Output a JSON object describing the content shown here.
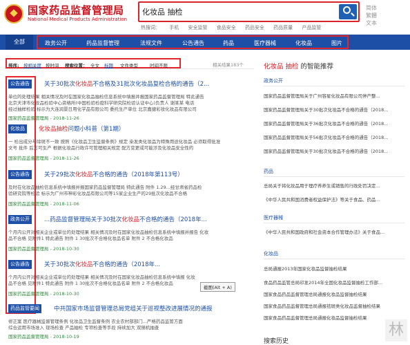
{
  "header": {
    "logo_cn": "国家药品监督管理局",
    "logo_en": "National Medical Products Administration",
    "search_value": "化妆品 抽检",
    "hotwords": [
      "热搜词：",
      "手机",
      "安全监管",
      "食品安全",
      "药品安全",
      "药品质量",
      "产品监管"
    ],
    "lang": [
      "简体",
      "繁體",
      "文本"
    ]
  },
  "nav": {
    "all": "全部",
    "items": [
      "政务公开",
      "药品监督管理",
      "法规文件",
      "公告通告",
      "药品",
      "医疗器械",
      "化妆品",
      "图片"
    ]
  },
  "filter": {
    "sort_label": "排序:",
    "sort_relevance": "按相关度",
    "sort_time": "按时间",
    "pos_label": "搜索位置：",
    "pos_all": "全文",
    "pos_title": "标题",
    "type": "文件类型",
    "time": "时间不限",
    "count": "相关结果183个"
  },
  "results": [
    {
      "tag": "公告通告",
      "title_pre": "关于30批次",
      "title_hl": "化妆品",
      "title_post": "不合格及31批次化妆品复检合格的通告（2...",
      "lines": [
        "单位的处理结果 相关情况及时在国家化妆品抽检信息系统中填报并报国家药品监督管理局 特此通告",
        "北京天津市化妆品检验中心资格所(中国检验检疫科学研究院检验认证中心)负责人 谢某某 电话",
        "经过抽样检验 标示为大连润景日用化学品有限公司 委托生产单位 北京嘉捷彩妆化妆品有限公司"
      ],
      "date": "国家药品监督管理局 - 2018-11-26"
    },
    {
      "tag": "化妆品",
      "title_pre": "",
      "title_hl": "化妆品抽检",
      "title_post": "问题小科普（第1期）",
      "lines": [
        "一 检出成分与除斑不一致 按照《化妆品卫生监督条例》规定 染发类化妆品为特殊用途化妆品 必须取得批准",
        "文号 批件 后方可生产 根据化妆品行政许可管理相关规定 配方变更或可能涉及化妆品安全性的"
      ],
      "date": "国家药品监督管理局 - 2018-11-26"
    },
    {
      "tag": "公告通告",
      "title_pre": "关于29批次",
      "title_hl": "化妆品",
      "title_post": "不合格的通告（2018年第113号）",
      "lines": [
        "及时在化妆品抽检信息系统中填报并报国家药品监督管理局 特此通告 附件 1.29...经甘肃省药品检",
        "验研究院等检验 标示为广州市神彩化妆品有限公司等15家企业生产的29批次化妆品不合格"
      ],
      "date": "国家药品监督管理局 - 2018-11-06"
    },
    {
      "tag": "政务公开",
      "title_pre": "...药品监督管理局关于30批次",
      "title_hl": "化妆品",
      "title_post": "不合格的通告（2018年...",
      "lines": [
        "个月内公开对相关企业或单位的处理结果 相关情况及时在国家化妆品抽检信息系统中填报并报告 化妆",
        "品不合格 见附件1 特此通告 附件 1 30批次不合格化妆品名单 附件 2 不合格化妆品"
      ],
      "date": "国家药品监督管理局 - 2018-10-30"
    },
    {
      "tag": "公告通告",
      "title_pre": "关于30批次",
      "title_hl": "化妆品",
      "title_post": "不合格的通告（2018年...",
      "lines": [
        "个月内公开对相关企业或单位的处理结果 相关情况及时在国家化妆品抽检信息系统中填报 化妆",
        "品不合格 见附件1 特此通告 附件 1 30批次不合格化妆品名单 附件 2 不合格化妆品"
      ],
      "date": "国家药品监督管理局 - 2018-10-30"
    },
    {
      "tag": "药品监管要闻",
      "title_pre": "中共国家市场监督管理总局党组关于巡视整改进展情况的通报",
      "title_hl": "",
      "title_post": "",
      "lines": [
        "修正案 医疗器械监督管理条例 化妆品卫生监督条例 农业农村部部门...严格药品监管方面",
        "综合运用市场准入 现场检查 产品抽检 专项检查等手段 持续加大 双随机抽查"
      ],
      "date": "国家药品监督管理局 - 2018-10-19"
    }
  ],
  "tooltip": "截图(Alt + A)",
  "right": {
    "title_hl": "化妆品 抽检",
    "title_post": " 的智能推荐",
    "sections": [
      {
        "name": "政务公开",
        "items": [
          "国家药品监督管理局关于广州容星化妆品有限公司停产整...",
          "国家药品监督管理局关于30批次化妆品不合格的通告（2018...",
          "国家药品监督管理局关于36批次化妆品不合格的通告（2018...",
          "国家药品监督管理局关于56批次化妆品不合格的通告（2018...",
          "国家药品监督管理局关于30批次化妆品不合格的通告（2018..."
        ]
      },
      {
        "name": "药品",
        "items": [
          "总局关于将化妆品用于理疗养养生或销售的行政处罚决定...",
          "《中华人民共和国消费者权益保护法》等关于食品、药品..."
        ]
      },
      {
        "name": "医疗器械",
        "items": [
          "《中华人民共和国政府和社会资本合作管理办法》关于食品..."
        ]
      },
      {
        "name": "化妆品",
        "items": [
          "总局通报2013年国家化妆品监督抽检结果",
          "食品药品监管总局印发2014年全国化妆品监督抽检工作部...",
          "国家食品药品监督管理总局通报化妆品监督抽检结果",
          "国家食品药品监督管理总局通报祛斑类化妆品监督抽检结果",
          "国家食品药品监督管理总局通报化妆品监督抽检结果"
        ]
      }
    ]
  },
  "history_label": "搜索历史",
  "watermark": "林"
}
